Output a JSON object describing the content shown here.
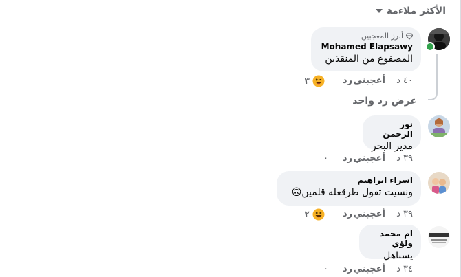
{
  "sort": {
    "label": "الأكثر ملاءمة"
  },
  "comments": [
    {
      "badge": "أبرز المعجبين",
      "author": "Mohamed Elapsawy",
      "text": "المصفوع من المنقذين",
      "time": "٤٠ د",
      "like": "أعجبني",
      "reply": "رد",
      "reaction_count": "٣"
    },
    {
      "author": "نور الرحمن",
      "text": "مدير البحر",
      "time": "٣٩ د",
      "like": "أعجبني",
      "reply": "رد",
      "reaction_count": "٠"
    },
    {
      "author": "اسراء ابراهيم",
      "text": "ونسيت تقول طرقعله قلمين🙃",
      "time": "٣٩ د",
      "like": "أعجبني",
      "reply": "رد",
      "reaction_count": "٢"
    },
    {
      "author": "ام محمد ولؤي",
      "text": "يستاهل",
      "time": "٣٤ د",
      "like": "أعجبني",
      "reply": "رد",
      "reaction_count": "٠"
    }
  ],
  "view_replies": {
    "label": "عرض رد واحد"
  },
  "colors": {
    "bubble": "#f0f2f5",
    "muted": "#65676b",
    "online": "#31a24c"
  }
}
